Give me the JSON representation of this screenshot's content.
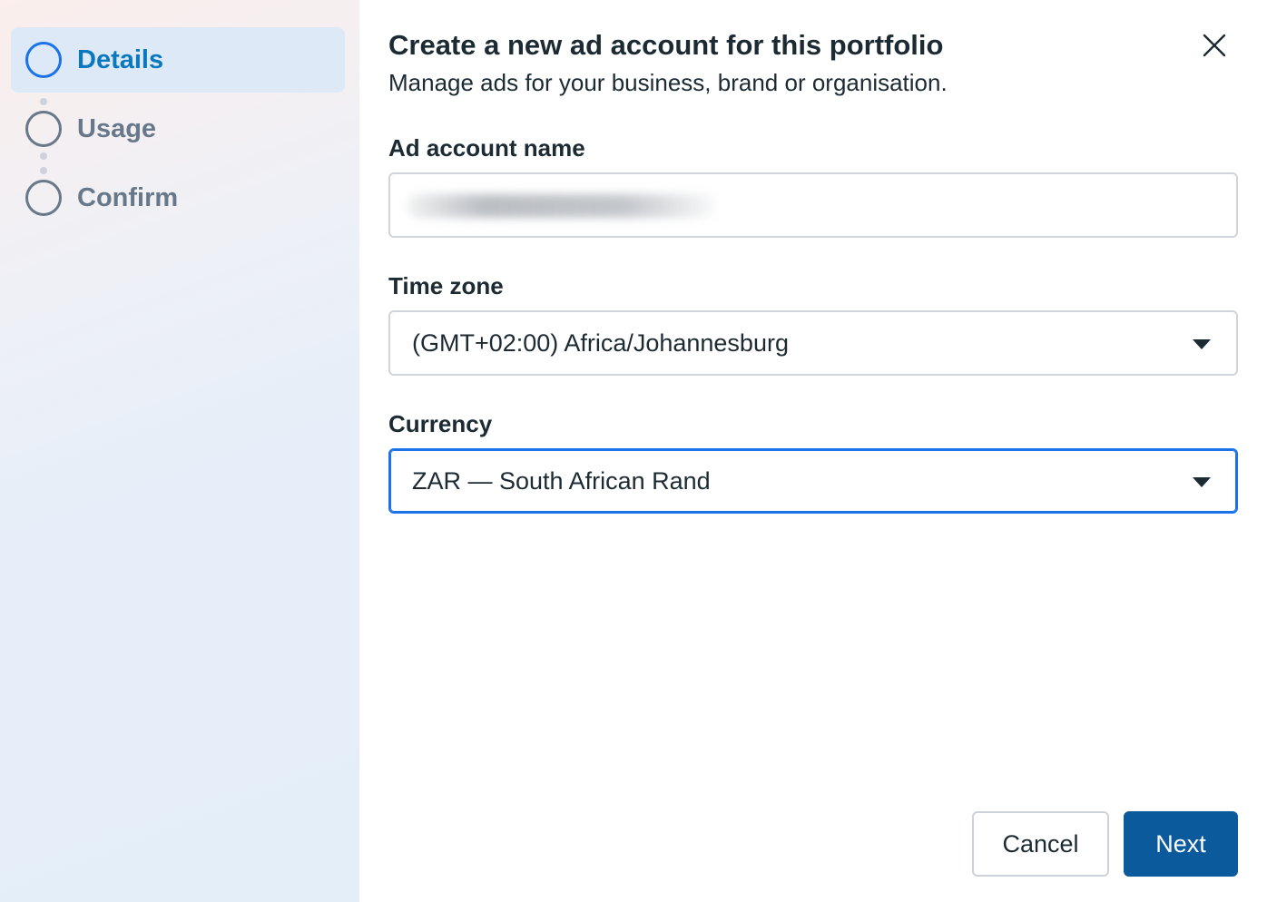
{
  "steps": [
    {
      "label": "Details",
      "state": "active"
    },
    {
      "label": "Usage",
      "state": "pending"
    },
    {
      "label": "Confirm",
      "state": "pending"
    }
  ],
  "dialog": {
    "title": "Create a new ad account for this portfolio",
    "subtitle": "Manage ads for your business, brand or organisation.",
    "close_icon": "close-icon"
  },
  "form": {
    "ad_account_name": {
      "label": "Ad account name",
      "value": ""
    },
    "time_zone": {
      "label": "Time zone",
      "value": "(GMT+02:00) Africa/Johannesburg"
    },
    "currency": {
      "label": "Currency",
      "value": "ZAR — South African Rand"
    }
  },
  "actions": {
    "cancel": "Cancel",
    "next": "Next"
  },
  "colors": {
    "accent": "#1a73e8",
    "primary_button": "#0a5a9c",
    "active_step_bg": "#dde9f6"
  }
}
